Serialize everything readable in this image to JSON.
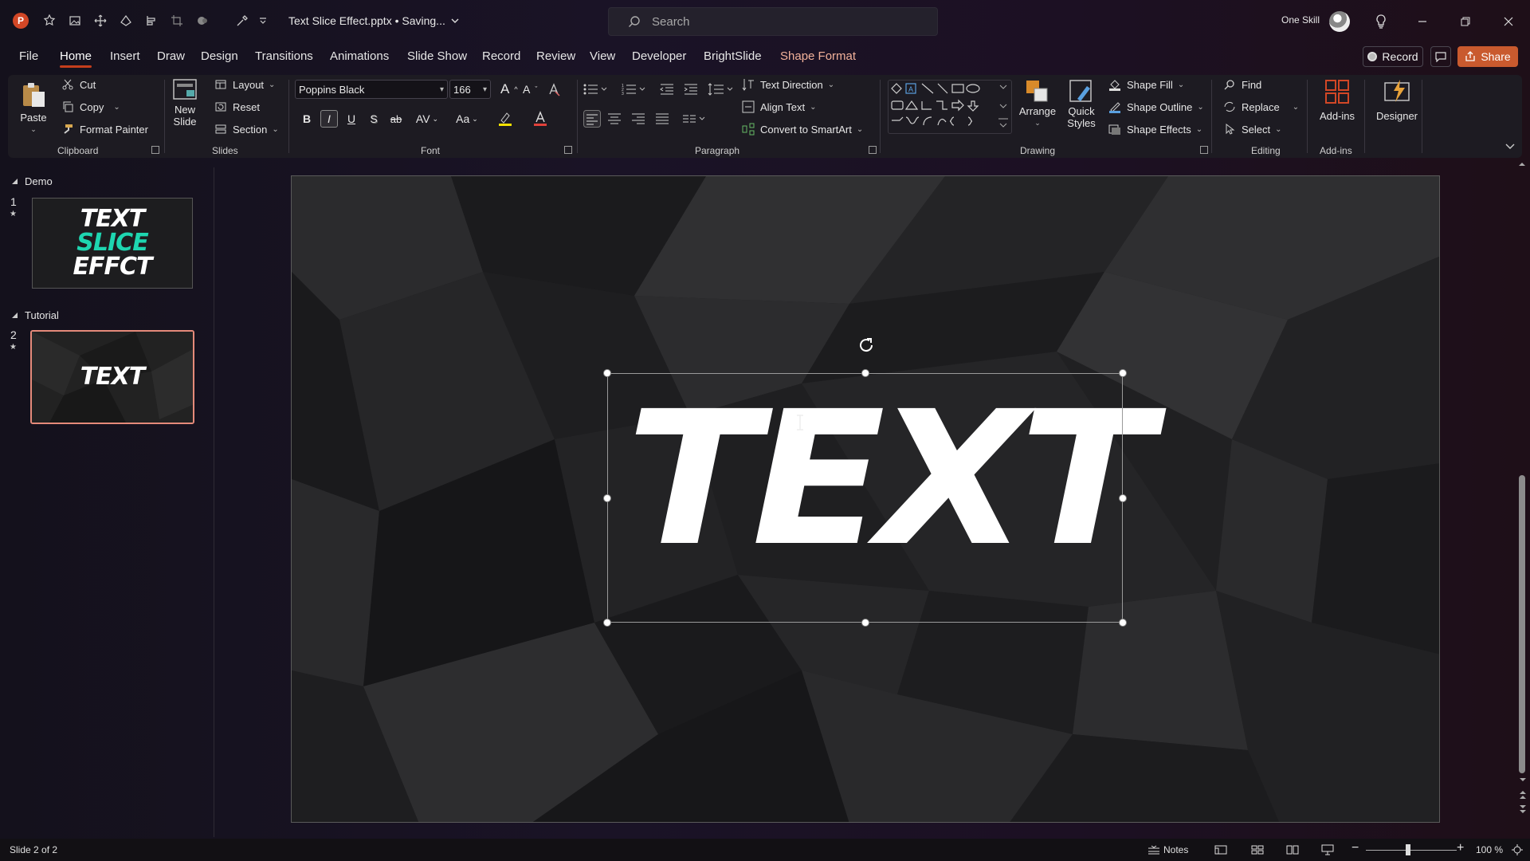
{
  "app": {
    "logo_letter": "P",
    "document_title": "Text Slice Effect.pptx • Saving...",
    "search_placeholder": "Search",
    "user_name": "One Skill"
  },
  "tabs": [
    {
      "label": "File"
    },
    {
      "label": "Home",
      "active": true
    },
    {
      "label": "Insert"
    },
    {
      "label": "Draw"
    },
    {
      "label": "Design"
    },
    {
      "label": "Transitions"
    },
    {
      "label": "Animations"
    },
    {
      "label": "Slide Show"
    },
    {
      "label": "Record"
    },
    {
      "label": "Review"
    },
    {
      "label": "View"
    },
    {
      "label": "Developer"
    },
    {
      "label": "BrightSlide"
    },
    {
      "label": "Shape Format",
      "contextual": true
    }
  ],
  "header_buttons": {
    "record": "Record",
    "share": "Share"
  },
  "ribbon": {
    "clipboard": {
      "paste": "Paste",
      "cut": "Cut",
      "copy": "Copy",
      "format_painter": "Format Painter",
      "label": "Clipboard"
    },
    "slides": {
      "new_slide": "New Slide",
      "layout": "Layout",
      "reset": "Reset",
      "section": "Section",
      "label": "Slides"
    },
    "font": {
      "font_name": "Poppins Black",
      "font_size": "166",
      "label": "Font",
      "bold": "B",
      "italic": "I",
      "underline": "U",
      "shadow": "S",
      "strike": "ab",
      "spacing": "AV",
      "case": "Aa",
      "grow": "A",
      "shrink": "A"
    },
    "paragraph": {
      "text_direction": "Text Direction",
      "align_text": "Align Text",
      "convert_smartart": "Convert to SmartArt",
      "label": "Paragraph"
    },
    "drawing": {
      "arrange": "Arrange",
      "quick_styles": "Quick Styles",
      "shape_fill": "Shape Fill",
      "shape_outline": "Shape Outline",
      "shape_effects": "Shape Effects",
      "label": "Drawing"
    },
    "editing": {
      "find": "Find",
      "replace": "Replace",
      "select": "Select",
      "label": "Editing"
    },
    "addins": {
      "addins": "Add-ins",
      "label": "Add-ins"
    },
    "designer": {
      "designer": "Designer"
    }
  },
  "slide_panel": {
    "sections": [
      {
        "name": "Demo",
        "slides": [
          {
            "number": "1",
            "lines": [
              "TEXT",
              "SLICE",
              "EFFCT"
            ]
          }
        ]
      },
      {
        "name": "Tutorial",
        "slides": [
          {
            "number": "2",
            "lines": [
              "TEXT"
            ]
          }
        ]
      }
    ]
  },
  "slide": {
    "text": "TEXT"
  },
  "status_bar": {
    "slide_info": "Slide 2 of 2",
    "notes": "Notes",
    "zoom": "100 %"
  },
  "colors": {
    "accent": "#c43e1c",
    "share": "#c95a2e",
    "teal": "#1ed6b0",
    "selected_thumb_border": "#e58a7a"
  }
}
